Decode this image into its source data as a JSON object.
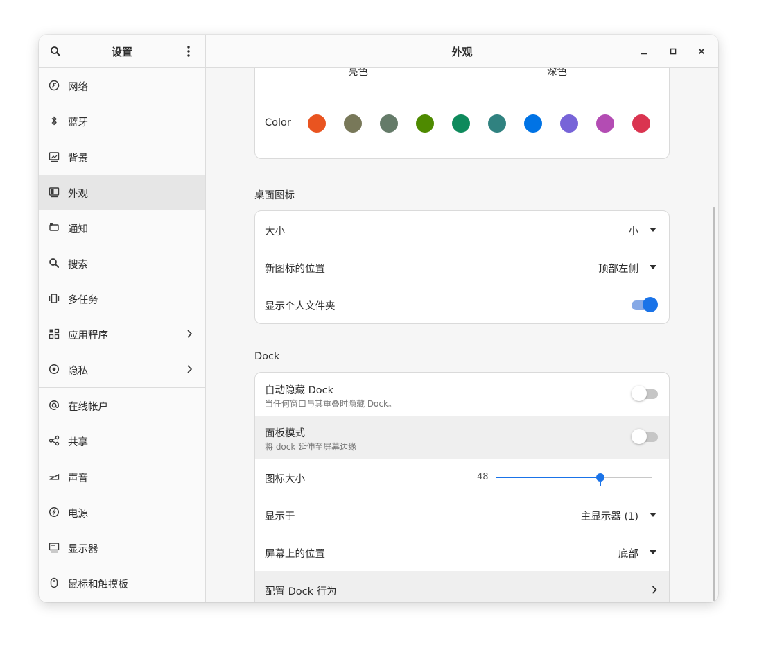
{
  "sidebar": {
    "title": "设置",
    "items": [
      {
        "label": "网络",
        "icon": "network-icon"
      },
      {
        "label": "蓝牙",
        "icon": "bluetooth-icon"
      },
      {
        "label": "背景",
        "icon": "background-icon"
      },
      {
        "label": "外观",
        "icon": "appearance-icon",
        "active": true
      },
      {
        "label": "通知",
        "icon": "notification-icon"
      },
      {
        "label": "搜索",
        "icon": "search-icon"
      },
      {
        "label": "多任务",
        "icon": "multitasking-icon"
      },
      {
        "label": "应用程序",
        "icon": "apps-icon",
        "chevron": true
      },
      {
        "label": "隐私",
        "icon": "privacy-icon",
        "chevron": true
      },
      {
        "label": "在线帐户",
        "icon": "at-icon"
      },
      {
        "label": "共享",
        "icon": "share-icon"
      },
      {
        "label": "声音",
        "icon": "sound-icon"
      },
      {
        "label": "电源",
        "icon": "power-icon"
      },
      {
        "label": "显示器",
        "icon": "display-icon"
      },
      {
        "label": "鼠标和触摸板",
        "icon": "mouse-icon"
      }
    ]
  },
  "main": {
    "title": "外观",
    "style": {
      "light_label": "亮色",
      "dark_label": "深色",
      "color_label": "Color",
      "accent_colors": [
        "#e95420",
        "#787859",
        "#657b69",
        "#4e8a00",
        "#0e8a5c",
        "#308280",
        "#0073e5",
        "#7764d8",
        "#b34cb3",
        "#da3450"
      ]
    },
    "desktop_icons": {
      "heading": "桌面图标",
      "size_label": "大小",
      "size_value": "小",
      "position_label": "新图标的位置",
      "position_value": "顶部左侧",
      "home_label": "显示个人文件夹",
      "home_on": true
    },
    "dock": {
      "heading": "Dock",
      "autohide_label": "自动隐藏 Dock",
      "autohide_sub": "当任何窗口与其重叠时隐藏 Dock。",
      "autohide_on": false,
      "panel_label": "面板模式",
      "panel_sub": "将 dock 延伸至屏幕边缘",
      "panel_on": false,
      "iconsize_label": "图标大小",
      "iconsize_value": "48",
      "iconsize_fraction": 0.67,
      "showon_label": "显示于",
      "showon_value": "主显示器 (1)",
      "screenpos_label": "屏幕上的位置",
      "screenpos_value": "底部",
      "configure_label": "配置 Dock 行为"
    }
  },
  "colors": {
    "accent": "#1a73e8"
  }
}
